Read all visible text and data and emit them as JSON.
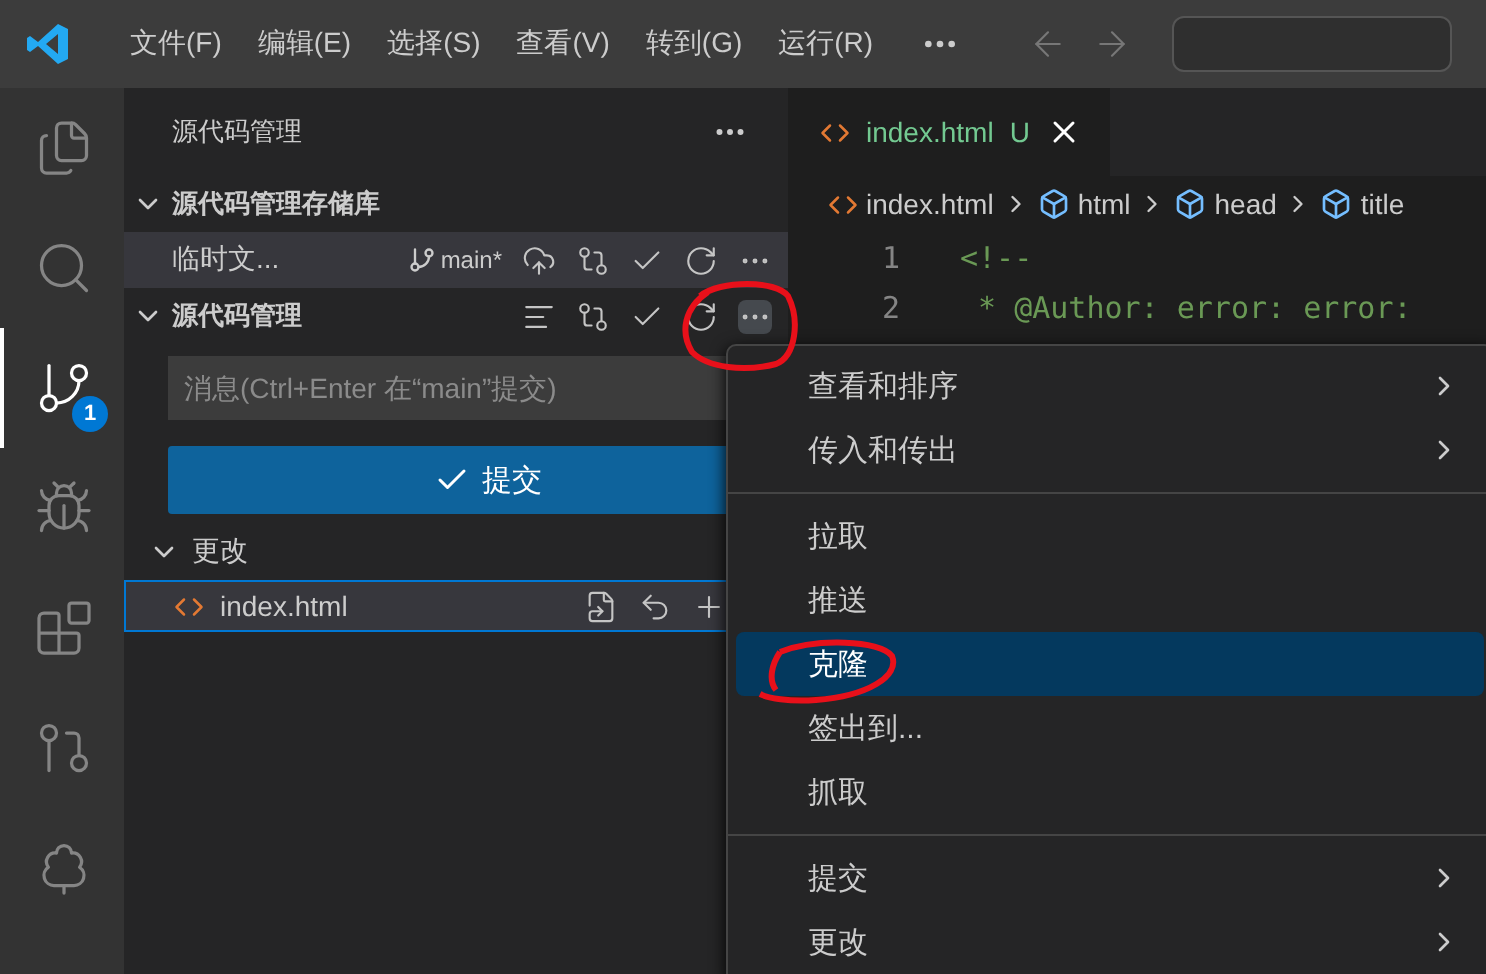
{
  "menubar": {
    "items": [
      "文件(F)",
      "编辑(E)",
      "选择(S)",
      "查看(V)",
      "转到(G)",
      "运行(R)"
    ]
  },
  "activity_bar": [
    {
      "kind": "explorer",
      "selected": false
    },
    {
      "kind": "search",
      "selected": false
    },
    {
      "kind": "scm",
      "selected": true,
      "badge": "1"
    },
    {
      "kind": "debug",
      "selected": false
    },
    {
      "kind": "extensions",
      "selected": false
    },
    {
      "kind": "remote",
      "selected": false
    },
    {
      "kind": "tree",
      "selected": false
    }
  ],
  "sidebar": {
    "title": "源代码管理",
    "repos_section": {
      "title": "源代码管理存储库",
      "expanded": true
    },
    "repo": {
      "name": "临时文...",
      "branch": "main*",
      "selected": true
    },
    "scm_section": {
      "title": "源代码管理",
      "expanded": true
    },
    "message": {
      "placeholder": "消息(Ctrl+Enter 在“main”提交)"
    },
    "commit_button": {
      "label": "提交"
    },
    "changes": {
      "title": "更改",
      "expanded": true,
      "files": [
        {
          "name": "index.html",
          "selected": true
        }
      ]
    }
  },
  "editor": {
    "tabs": [
      {
        "label": "index.html",
        "status": "U",
        "selected": true
      }
    ],
    "breadcrumbs": [
      {
        "kind": "file",
        "label": "index.html"
      },
      {
        "kind": "element",
        "label": "html"
      },
      {
        "kind": "element",
        "label": "head"
      },
      {
        "kind": "element",
        "label": "title"
      }
    ],
    "lines": [
      {
        "number": "1",
        "text": "<!--"
      },
      {
        "number": "2",
        "text": " * @Author: error: error:"
      }
    ]
  },
  "context_menu": {
    "groups": [
      [
        {
          "label": "查看和排序",
          "submenu": true,
          "selected": false
        },
        {
          "label": "传入和传出",
          "submenu": true,
          "selected": false
        }
      ],
      [
        {
          "label": "拉取",
          "submenu": false,
          "selected": false
        },
        {
          "label": "推送",
          "submenu": false,
          "selected": false
        },
        {
          "label": "克隆",
          "submenu": false,
          "selected": true
        },
        {
          "label": "签出到...",
          "submenu": false,
          "selected": false
        },
        {
          "label": "抓取",
          "submenu": false,
          "selected": false
        }
      ],
      [
        {
          "label": "提交",
          "submenu": true,
          "selected": false
        },
        {
          "label": "更改",
          "submenu": true,
          "selected": false
        }
      ]
    ]
  }
}
